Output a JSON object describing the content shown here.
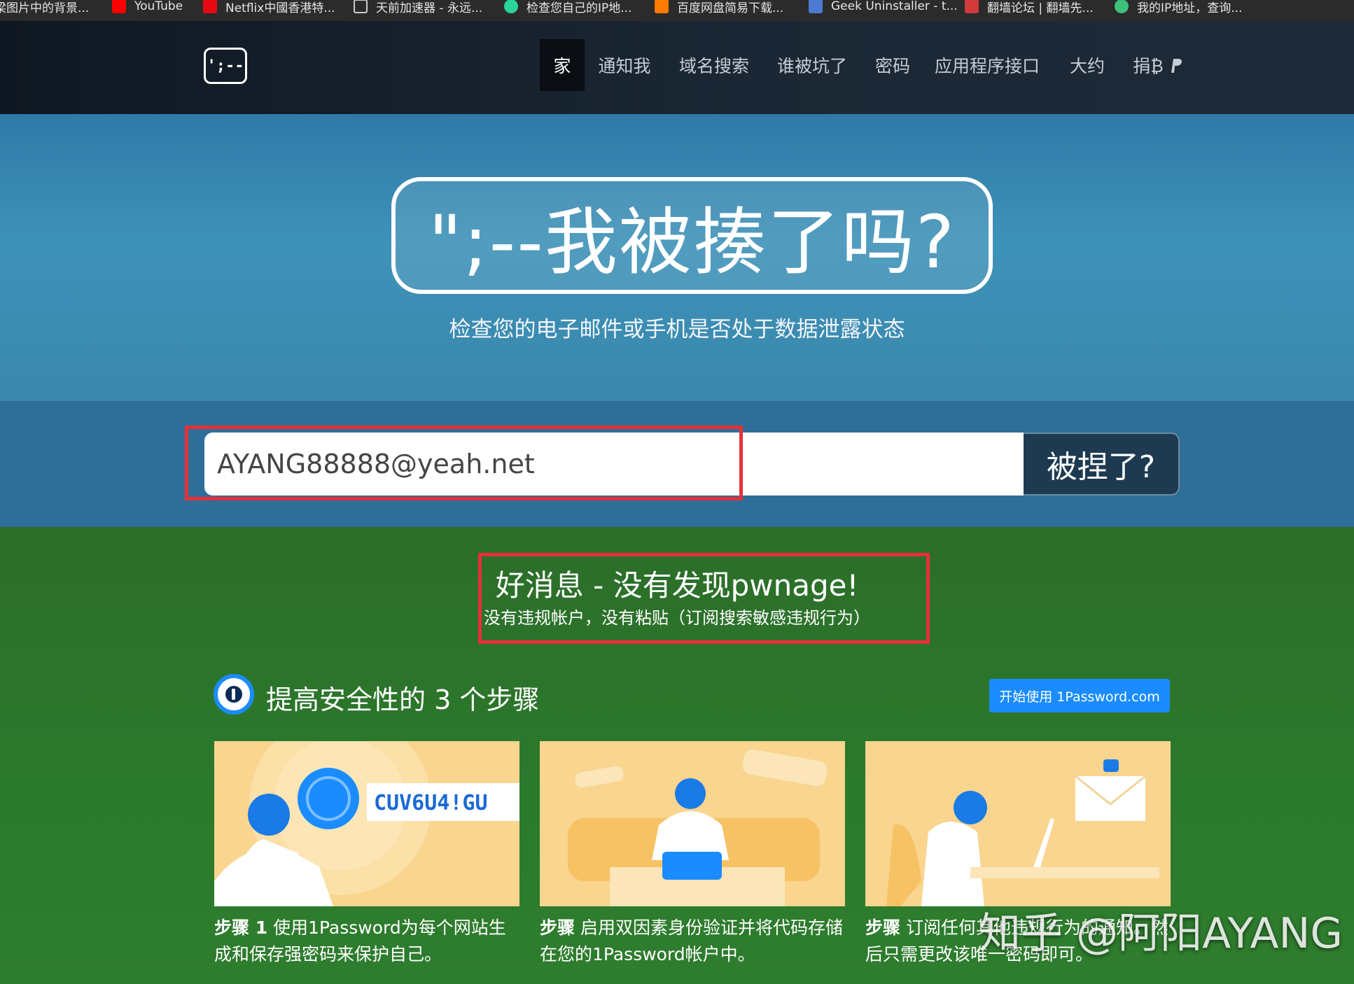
{
  "bookmarks": [
    {
      "label": "梁图片中的背景...",
      "color": "#3a6bd6"
    },
    {
      "label": "YouTube",
      "color": "#ff0000"
    },
    {
      "label": "Netflix中國香港特...",
      "color": "#e50914"
    },
    {
      "label": "天前加速器 - 永远...",
      "color": "#cccccc"
    },
    {
      "label": "检查您自己的IP地...",
      "color": "#2bd39a"
    },
    {
      "label": "百度网盘简易下载...",
      "color": "#ff7a00"
    },
    {
      "label": "Geek Uninstaller - t...",
      "color": "#4a7bd0"
    },
    {
      "label": "翻墙论坛 | 翻墙先...",
      "color": "#d03a3a"
    },
    {
      "label": "我的IP地址，查询...",
      "color": "#3cc07a"
    }
  ],
  "logo_text": "';--",
  "nav": [
    {
      "label": "家",
      "active": true
    },
    {
      "label": "通知我"
    },
    {
      "label": "域名搜索"
    },
    {
      "label": "谁被坑了"
    },
    {
      "label": "密码"
    },
    {
      "label": "应用程序接口"
    },
    {
      "label": "大约"
    },
    {
      "label": "捐₿",
      "icon": "paypal-icon"
    }
  ],
  "hero": {
    "title": "\";--我被揍了吗?",
    "subtitle": "检查您的电子邮件或手机是否处于数据泄露状态"
  },
  "search": {
    "value": "AYANG88888@yeah.net",
    "button_label": "被捏了?"
  },
  "result": {
    "title": "好消息 - 没有发现pwnage!",
    "subtitle": "没有违规帐户，没有粘贴（订阅搜索敏感违规行为）"
  },
  "steps": {
    "title": "提高安全性的 3 个步骤",
    "cta_label": "开始使用 1Password.com",
    "password_sample": "CUV6U4!GU",
    "cards": [
      {
        "step_label": "步骤 1",
        "text": " 使用1Password为每个网站生成和保存强密码来保护自己。"
      },
      {
        "step_label": "步骤",
        "text": " 启用双因素身份验证并将代码存储在您的1Password帐户中。"
      },
      {
        "step_label": "步骤",
        "text": " 订阅任何其他违规行为的通知。然后只需更改该唯一密码即可。"
      }
    ]
  },
  "watermark": "知乎 @阿阳AYANG",
  "colors": {
    "highlight": "#e53038",
    "cta": "#1a8cff",
    "good_news_bg": "#2c6d2a",
    "hero_bg": "#3e92b8"
  }
}
